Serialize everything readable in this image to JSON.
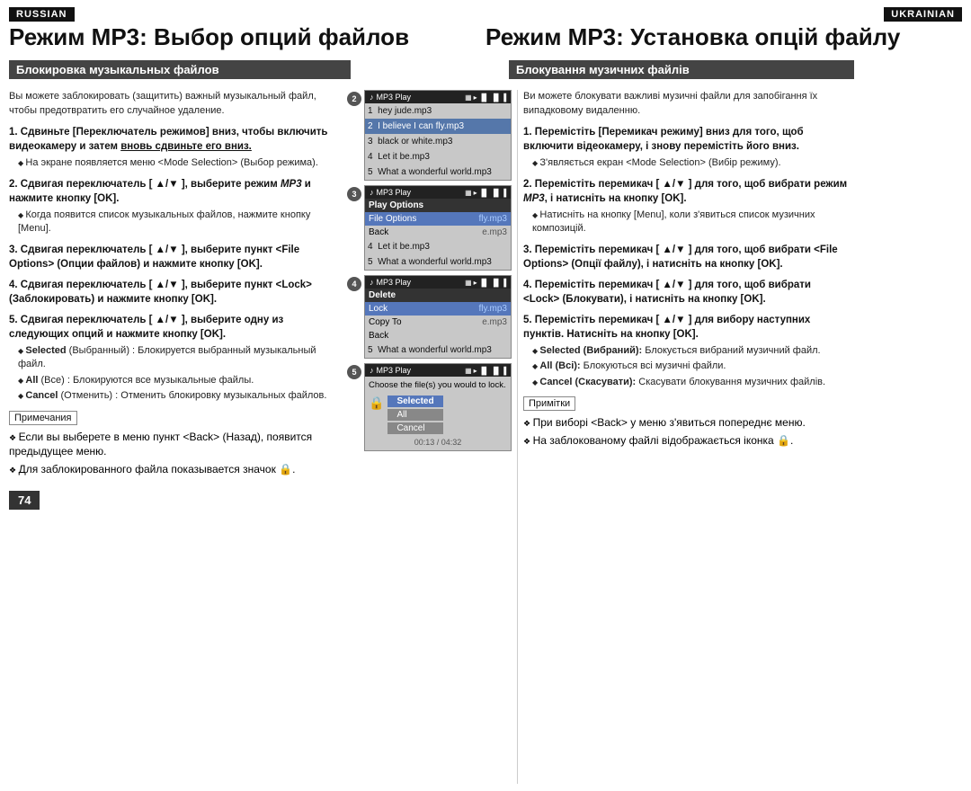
{
  "page": {
    "lang_left": "RUSSIAN",
    "lang_right": "UKRAINIAN",
    "title_left": "Режим MP3: Выбор опций файлов",
    "title_right": "Режим MP3: Установка опцій файлу",
    "section_header_left": "Блокировка музыкальных файлов",
    "section_header_right": "Блокування музичних файлів",
    "intro_left": "Вы можете заблокировать (защитить) важный музыкальный файл, чтобы предотвратить его случайное удаление.",
    "intro_right": "Ви можете блокувати важливі музичні файли для запобігання їх випадковому видаленню.",
    "page_number": "74",
    "steps_left": [
      {
        "num": "1.",
        "text": "Сдвиньте [Переключатель режимов] вниз, чтобы включить видеокамеру и затем вновь сдвиньте его вниз.",
        "sub": [
          "На экране появляется меню <Mode Selection> (Выбор режима)."
        ]
      },
      {
        "num": "2.",
        "text": "Сдвигая переключатель [ ▲/▼ ], выберите режим MP3 и нажмите кнопку [OK].",
        "sub": [
          "Когда появится список музыкальных файлов, нажмите кнопку [Menu]."
        ]
      },
      {
        "num": "3.",
        "text": "Сдвигая переключатель [ ▲/▼ ], выберите пункт <File Options> (Опции файлов) и нажмите кнопку [OK].",
        "sub": []
      },
      {
        "num": "4.",
        "text": "Сдвигая переключатель [ ▲/▼ ], выберите пункт <Lock> (Заблокировать) и нажмите кнопку [OK].",
        "sub": []
      },
      {
        "num": "5.",
        "text": "Сдвигая переключатель [ ▲/▼ ], выберите одну из следующих опций и нажмите кнопку [OK].",
        "sub": [
          "Selected (Выбранный) : Блокируется выбранный музыкальный файл.",
          "All (Все) : Блокируются все музыкальные файлы.",
          "Cancel (Отменить) : Отменить блокировку музыкальных файлов."
        ]
      }
    ],
    "steps_right": [
      {
        "num": "1.",
        "text": "Перемістіть [Перемикач режиму] вниз для того, щоб включити відеокамеру, і знову перемістіть його вниз.",
        "sub": [
          "З'являється екран <Mode Selection> (Вибір режиму)."
        ]
      },
      {
        "num": "2.",
        "text": "Перемістіть перемикач [ ▲/▼ ] для того, щоб вибрати режим MP3, і натисніть на кнопку [OK].",
        "sub": [
          "Натисніть на кнопку [Menu], коли з'явиться список музичних композицій."
        ]
      },
      {
        "num": "3.",
        "text": "Перемістіть перемикач [ ▲/▼ ] для того, щоб вибрати <File Options> (Опції файлу), і натисніть на кнопку [OK].",
        "sub": []
      },
      {
        "num": "4.",
        "text": "Перемістіть перемикач [ ▲/▼ ] для того, щоб вибрати <Lock> (Блокувати), і натисніть на кнопку [OK].",
        "sub": []
      },
      {
        "num": "5.",
        "text": "Перемістіть перемикач [ ▲/▼ ] для вибору наступних пунктів. Натисніть на кнопку [OK].",
        "sub": [
          "Selected (Вибраний): Блокується вибраний музичний файл.",
          "All (Всі): Блокуються всі музичні файли.",
          "Cancel (Скасувати): Скасувати блокування музичних файлів."
        ]
      }
    ],
    "notes_left_title": "Примечания",
    "notes_left": [
      "Если вы выберете в меню пункт <Back> (Назад), появится предыдущее меню.",
      "Для заблокированного файла показывается значок 🔒."
    ],
    "notes_right_title": "Примітки",
    "notes_right": [
      "При виборі <Back> у меню з'явиться попереднє меню.",
      "На заблокованому файлі відображається іконка 🔒."
    ],
    "screens": [
      {
        "step": "2",
        "header": "♪ MP3 Play",
        "items": [
          {
            "text": "1  hey jude.mp3",
            "style": "normal"
          },
          {
            "text": "2  I believe I can fly.mp3",
            "style": "selected"
          },
          {
            "text": "3  black or white.mp3",
            "style": "normal"
          },
          {
            "text": "4  Let it be.mp3",
            "style": "normal"
          },
          {
            "text": "5  What a wonderful world.mp3",
            "style": "normal"
          }
        ]
      },
      {
        "step": "3",
        "header": "♪ MP3 Play",
        "menu": [
          {
            "label": "Play Options",
            "style": "dark"
          },
          {
            "label": "File Options",
            "value": "fly.mp3",
            "style": "highlight"
          },
          {
            "label": "Back",
            "value": "e.mp3",
            "style": "normal"
          }
        ],
        "items_below": [
          {
            "text": "4  Let it be.mp3",
            "style": "normal"
          },
          {
            "text": "5  What a wonderful world.mp3",
            "style": "normal"
          }
        ]
      },
      {
        "step": "4",
        "header": "♪ MP3 Play",
        "menu": [
          {
            "label": "Delete",
            "style": "dark"
          },
          {
            "label": "Lock",
            "value": "fly.mp3",
            "style": "highlight"
          },
          {
            "label": "Copy To",
            "value": "e.mp3",
            "style": "normal"
          },
          {
            "label": "Back",
            "style": "normal"
          }
        ],
        "items_below": [
          {
            "text": "5  What a wonderful world.mp3",
            "style": "normal"
          }
        ]
      },
      {
        "step": "5",
        "header": "♪ MP3 Play",
        "prompt": "Choose the file(s) you would to lock.",
        "options": [
          "Selected",
          "All",
          "Cancel"
        ],
        "timecode": "00:13 / 04:32"
      }
    ]
  }
}
